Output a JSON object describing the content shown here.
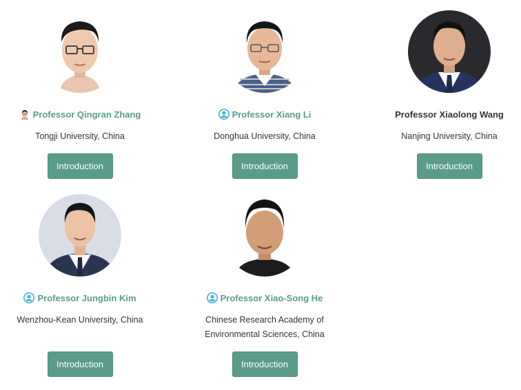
{
  "colors": {
    "accent": "#5a9b8a",
    "button_text": "#ffffff",
    "name_default": "#333333",
    "text": "#333333",
    "user_icon": "#43b2e0"
  },
  "people": [
    {
      "name": "Professor Qingran Zhang",
      "affiliation_lines": [
        "Tongji University, China"
      ],
      "button_label": "Introduction",
      "name_icon": "mini-portrait-icon"
    },
    {
      "name": "Professor Xiang Li",
      "affiliation_lines": [
        "Donghua University, China"
      ],
      "button_label": "Introduction",
      "name_icon": "user-icon"
    },
    {
      "name": "Professor Xiaolong Wang",
      "affiliation_lines": [
        "Nanjing University, China"
      ],
      "button_label": "Introduction",
      "name_icon": ""
    },
    {
      "name": "Professor Jungbin Kim",
      "affiliation_lines": [
        "Wenzhou-Kean University, China"
      ],
      "button_label": "Introduction",
      "name_icon": "user-icon"
    },
    {
      "name": "Professor Xiao-Song He",
      "affiliation_lines": [
        "Chinese Research Academy of",
        "Environmental Sciences, China"
      ],
      "button_label": "Introduction",
      "name_icon": "user-icon"
    }
  ]
}
